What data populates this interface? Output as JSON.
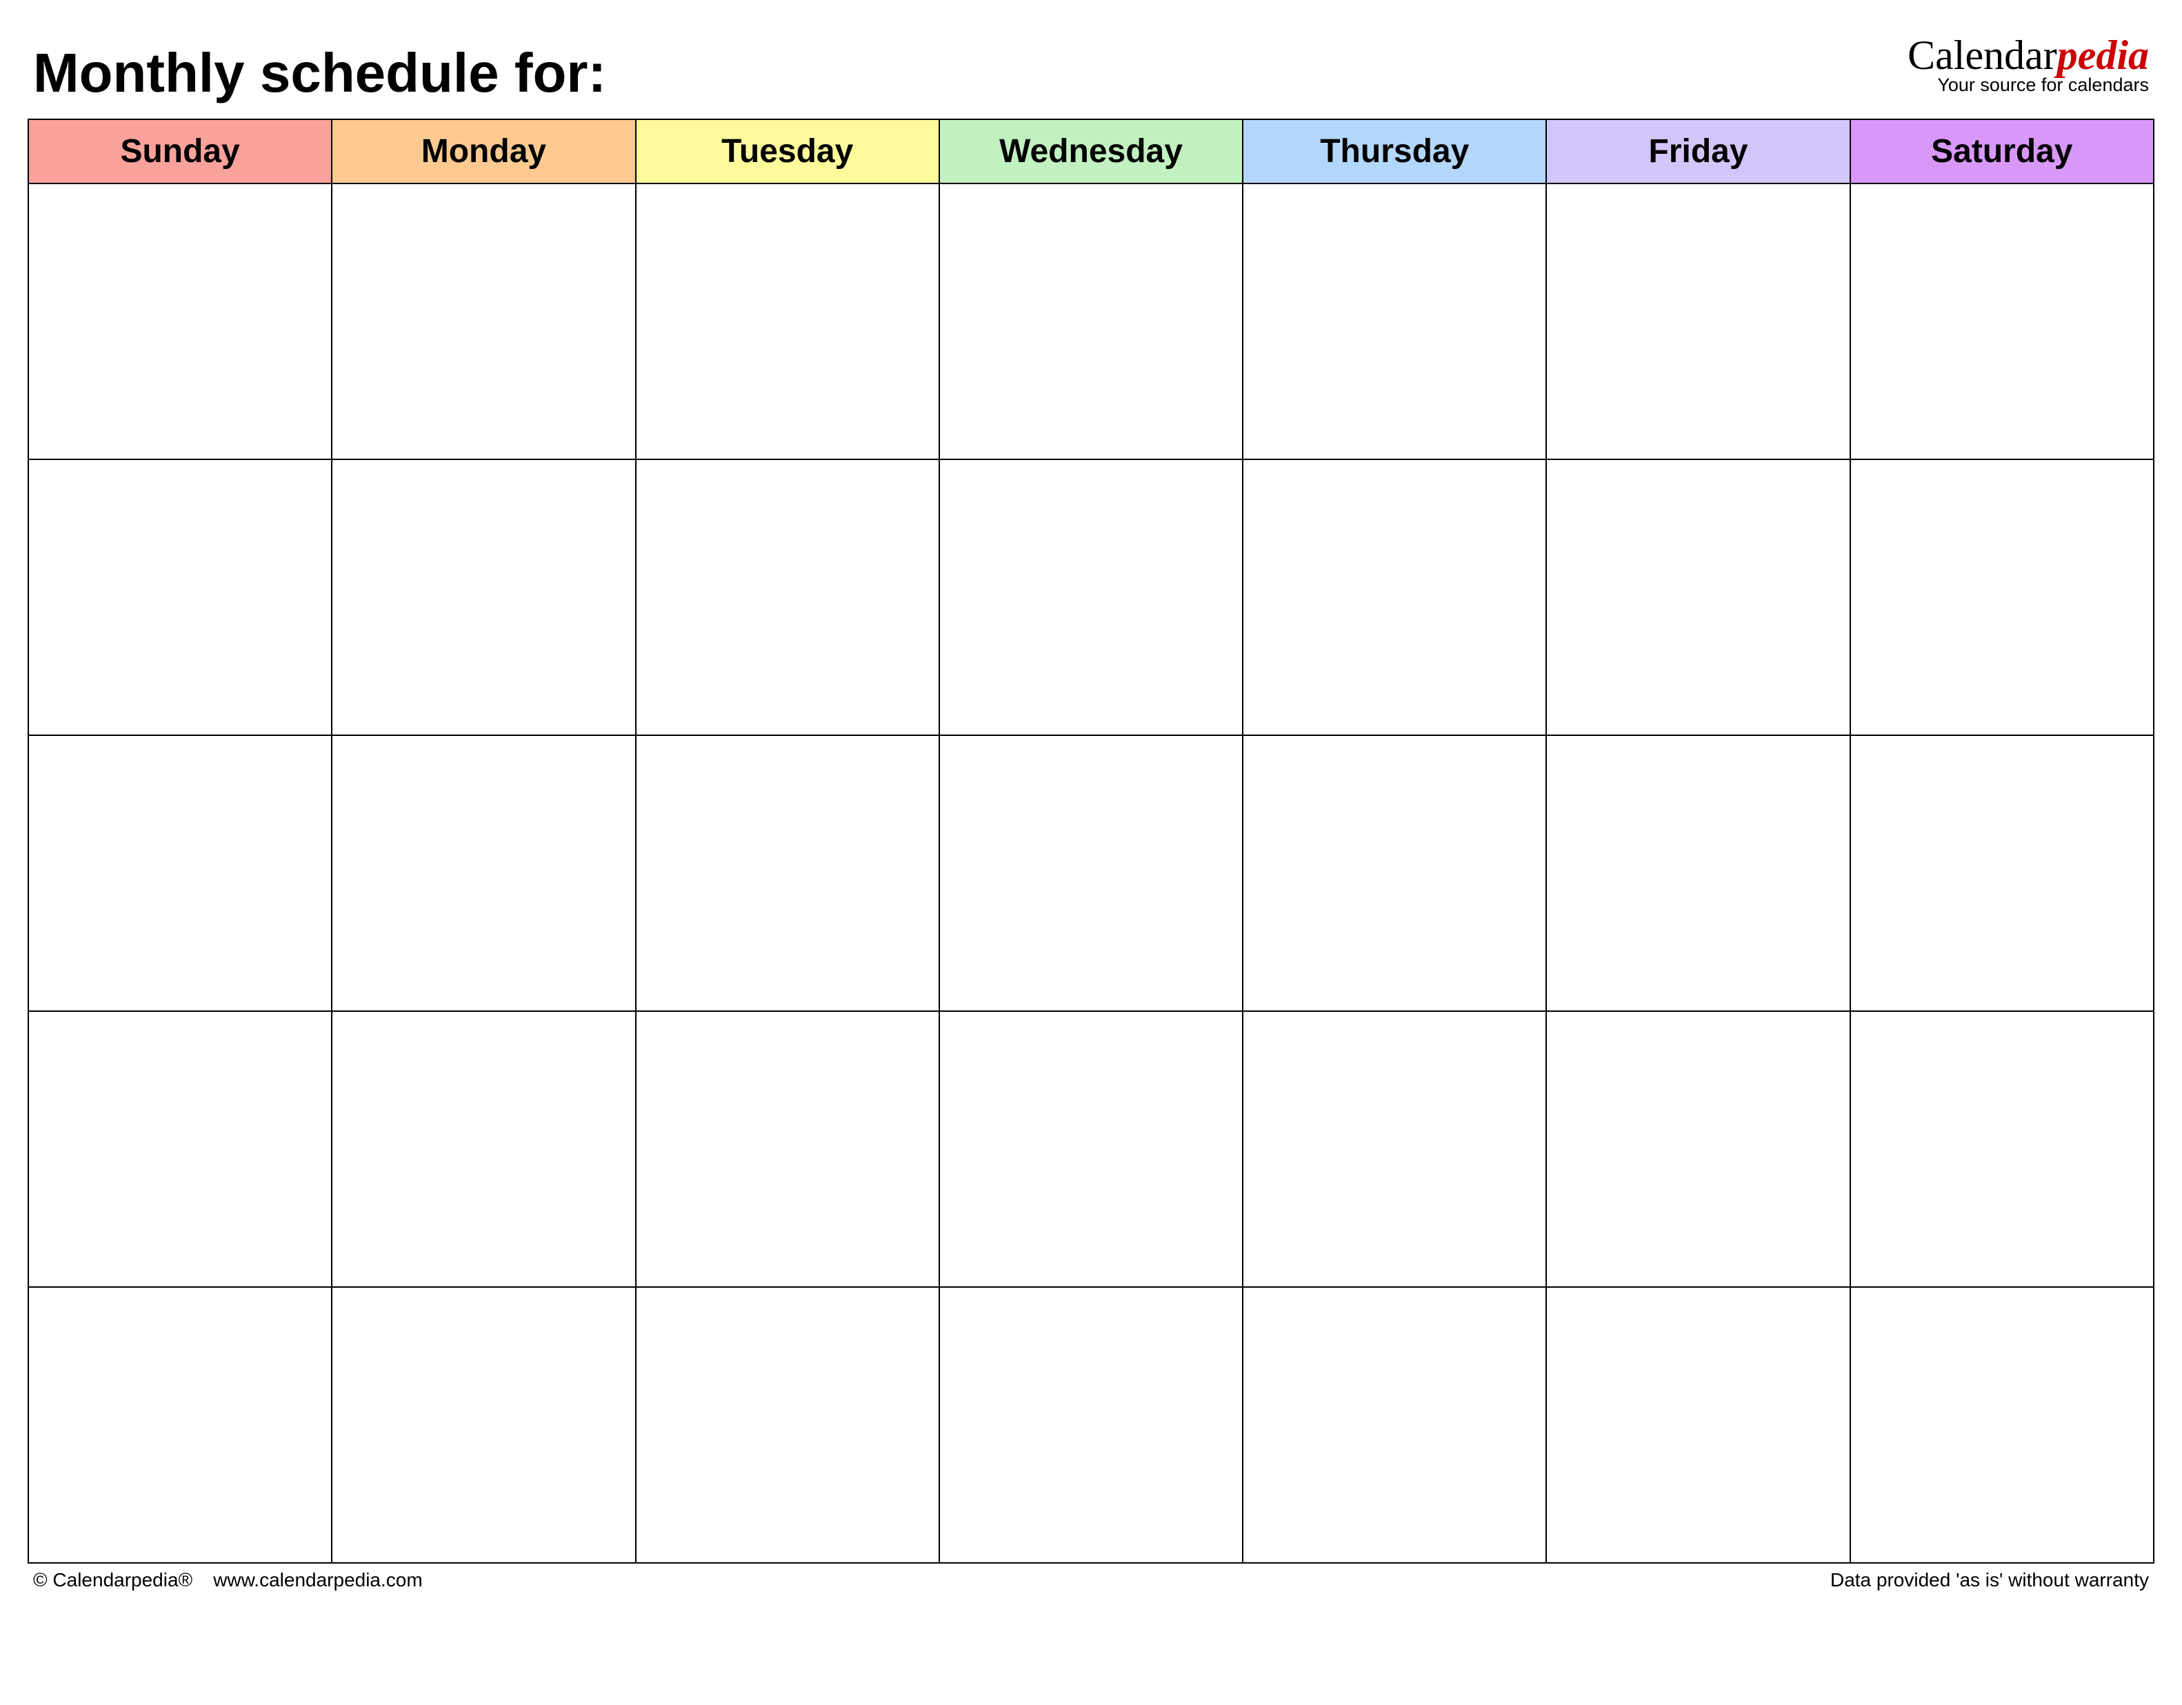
{
  "header": {
    "title": "Monthly schedule for:"
  },
  "logo": {
    "part1": "Calendar",
    "part2": "pedia",
    "tagline": "Your source for calendars"
  },
  "days": {
    "sun": "Sunday",
    "mon": "Monday",
    "tue": "Tuesday",
    "wed": "Wednesday",
    "thu": "Thursday",
    "fri": "Friday",
    "sat": "Saturday"
  },
  "footer": {
    "copyright": "© Calendarpedia®",
    "url": "www.calendarpedia.com",
    "disclaimer": "Data provided 'as is' without warranty"
  }
}
